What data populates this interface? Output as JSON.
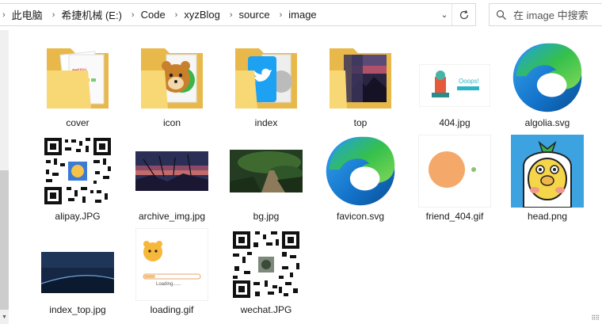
{
  "address_bar": {
    "crumbs": [
      "此电脑",
      "希捷机械 (E:)",
      "Code",
      "xyzBlog",
      "source",
      "image"
    ]
  },
  "search": {
    "placeholder": "在 image 中搜索"
  },
  "files": [
    {
      "name": "cover",
      "kind": "folder",
      "icon": "folder-icon"
    },
    {
      "name": "icon",
      "kind": "folder",
      "icon": "folder-icon"
    },
    {
      "name": "index",
      "kind": "folder",
      "icon": "folder-icon"
    },
    {
      "name": "top",
      "kind": "folder",
      "icon": "folder-icon"
    },
    {
      "name": "404.jpg",
      "kind": "image"
    },
    {
      "name": "algolia.svg",
      "kind": "svg",
      "icon": "edge-icon"
    },
    {
      "name": "alipay.JPG",
      "kind": "image"
    },
    {
      "name": "archive_img.jpg",
      "kind": "image"
    },
    {
      "name": "bg.jpg",
      "kind": "image"
    },
    {
      "name": "favicon.svg",
      "kind": "svg",
      "icon": "edge-icon"
    },
    {
      "name": "friend_404.gif",
      "kind": "image"
    },
    {
      "name": "head.png",
      "kind": "image"
    },
    {
      "name": "index_top.jpg",
      "kind": "image"
    },
    {
      "name": "loading.gif",
      "kind": "image"
    },
    {
      "name": "wechat.JPG",
      "kind": "image"
    }
  ],
  "image_text": {
    "oops": "Ooops!",
    "loading": "Loading......"
  },
  "colors": {
    "folder": "#f8d775",
    "edge_blue": "#0c59a4",
    "edge_green": "#35c04c",
    "accent": "#0078d4"
  }
}
